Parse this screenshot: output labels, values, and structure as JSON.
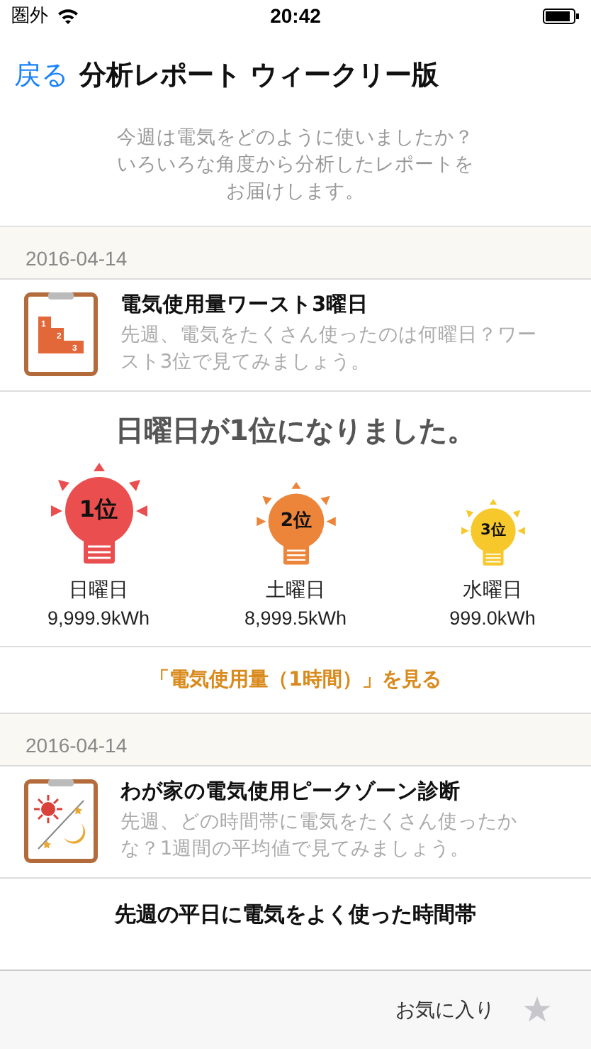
{
  "status_bar": {
    "carrier": "圏外",
    "time": "20:42"
  },
  "nav": {
    "back": "戻る",
    "title": "分析レポート ウィークリー版"
  },
  "intro": [
    "今週は電気をどのように使いましたか？",
    "いろいろな角度から分析したレポートを",
    "お届けします。"
  ],
  "sections": [
    {
      "date": "2016-04-14",
      "kind": "podium",
      "podium_steps": [
        "1",
        "2",
        "3"
      ],
      "title": "電気使用量ワースト3曜日",
      "description": "先週、電気をたくさん使ったのは何曜日？ワースト3位で見てみましょう。",
      "headline": "日曜日が1位になりました。",
      "ranking": [
        {
          "rank": "1位",
          "day": "日曜日",
          "value": "9,999.9kWh",
          "color": "#ea4e4e"
        },
        {
          "rank": "2位",
          "day": "土曜日",
          "value": "8,999.5kWh",
          "color": "#ec853a"
        },
        {
          "rank": "3位",
          "day": "水曜日",
          "value": "999.0kWh",
          "color": "#f6c82b"
        }
      ],
      "link": "「電気使用量（1時間）」を見る"
    },
    {
      "date": "2016-04-14",
      "kind": "day-night",
      "title": "わが家の電気使用ピークゾーン診断",
      "description": "先週、どの時間帯に電気をたくさん使ったかな？1週間の平均値で見てみましょう。",
      "headline": "先週の平日に電気をよく使った時間帯"
    }
  ],
  "footer": {
    "favorite": "お気に入り"
  }
}
